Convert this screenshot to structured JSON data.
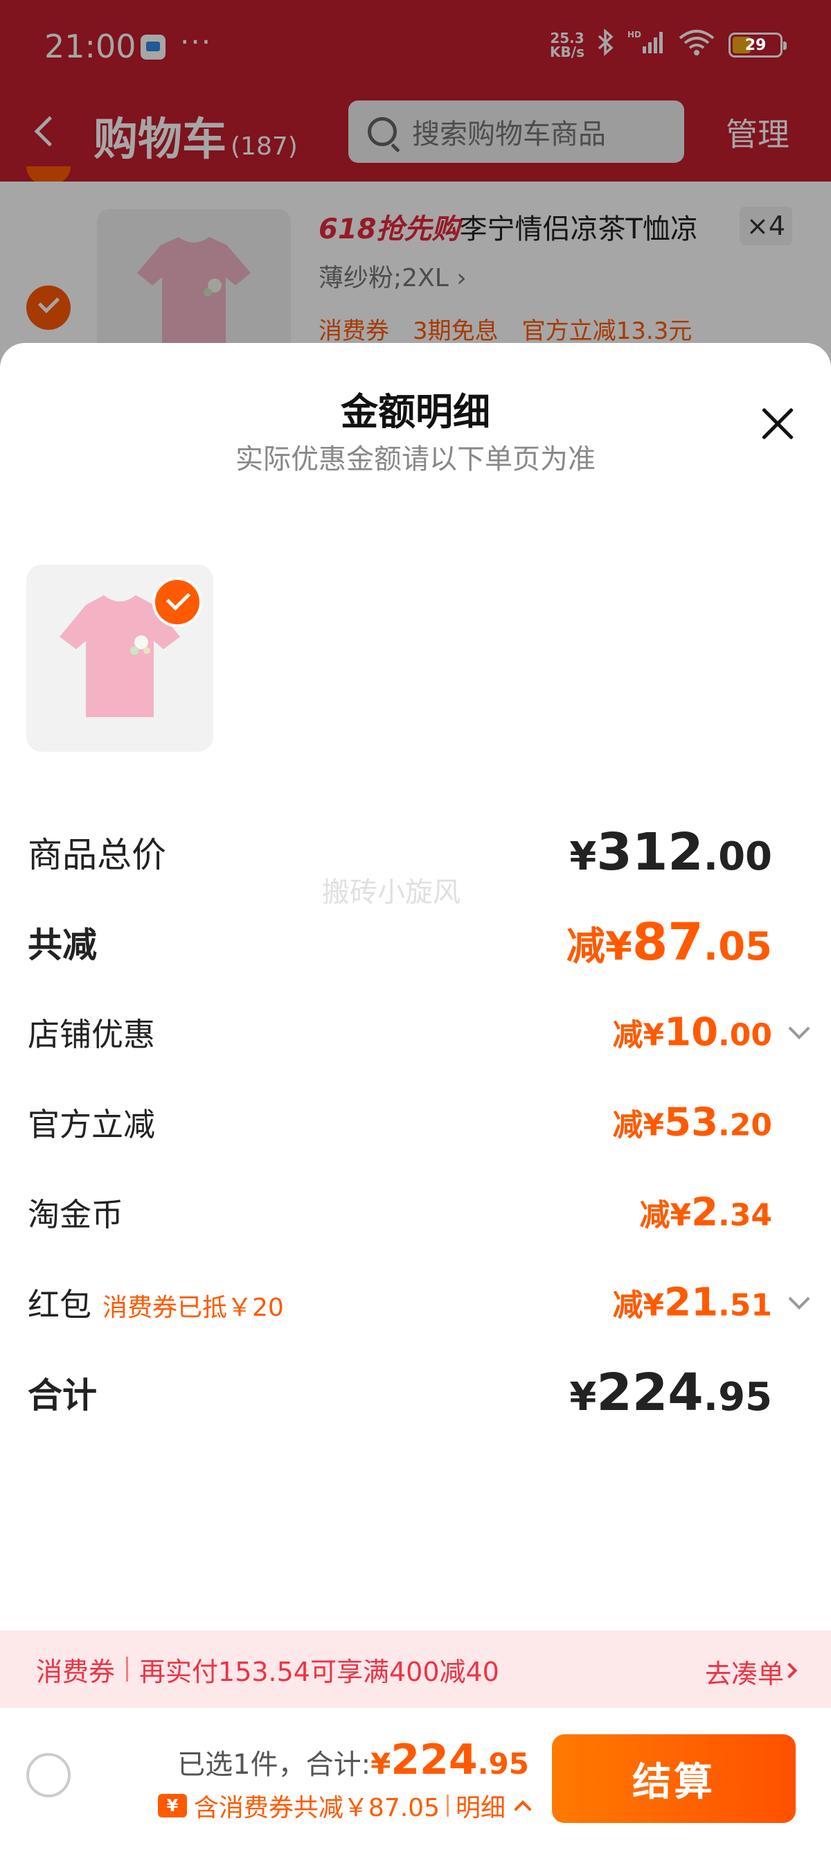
{
  "status_bar": {
    "time": "21:00",
    "dots": "···",
    "net_speed_value": "25.3",
    "net_speed_unit": "KB/s",
    "battery": "29"
  },
  "header": {
    "title": "购物车",
    "count": "(187)",
    "search_placeholder": "搜索购物车商品",
    "manage_label": "管理"
  },
  "cart_item": {
    "promo_label": "618抢先购",
    "title": "李宁情侣凉茶T恤凉",
    "quantity": "×4",
    "sku": "薄纱粉;2XL ›",
    "tags": [
      "消费券",
      "3期免息",
      "官方立减13.3元"
    ]
  },
  "sheet": {
    "title": "金额明细",
    "subtitle": "实际优惠金额请以下单页为准",
    "watermark": "搬砖小旋风",
    "rows": [
      {
        "label": "商品总价",
        "prefix": "",
        "yen": "¥",
        "int": "312",
        "dec": ".00"
      },
      {
        "label": "共减",
        "prefix": "减",
        "yen": "¥",
        "int": "87",
        "dec": ".05"
      },
      {
        "label": "店铺优惠",
        "prefix": "减",
        "yen": "¥",
        "int": "10",
        "dec": ".00"
      },
      {
        "label": "官方立减",
        "prefix": "减",
        "yen": "¥",
        "int": "53",
        "dec": ".20"
      },
      {
        "label": "淘金币",
        "prefix": "减",
        "yen": "¥",
        "int": "2",
        "dec": ".34"
      },
      {
        "label": "红包",
        "note": "消费券已抵￥20",
        "prefix": "减",
        "yen": "¥",
        "int": "21",
        "dec": ".51"
      },
      {
        "label": "合计",
        "prefix": "",
        "yen": "¥",
        "int": "224",
        "dec": ".95"
      }
    ]
  },
  "coupon_bar": {
    "tag": "消费券",
    "text": "再实付153.54可享满400减40",
    "link": "去凑单"
  },
  "checkout": {
    "selected_text": "已选1件，合计:",
    "yen": "¥",
    "int": "224",
    "dec": ".95",
    "coupon_icon": "¥",
    "coupon_text": "含消费券共减￥87.05",
    "detail_label": "明细",
    "button_label": "结算"
  },
  "colors": {
    "brand_red": "#c41e2e",
    "accent_orange": "#ff5a00",
    "coupon_pink_bg": "#fde8ea"
  }
}
